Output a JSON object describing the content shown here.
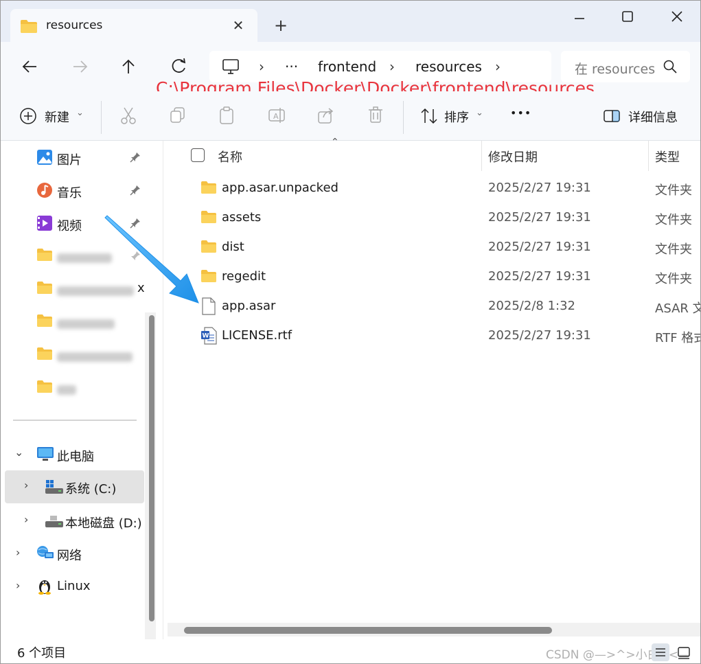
{
  "window": {
    "tab_title": "resources",
    "tab_close": "✕",
    "new_tab": "+"
  },
  "address": {
    "more": "···",
    "crumbs": [
      "frontend",
      "resources"
    ],
    "sep": "›",
    "search_placeholder": "在 resources 中搜索"
  },
  "annotation": {
    "path": "C:\\Program Files\\Docker\\Docker\\frontend\\resources"
  },
  "toolbar": {
    "new_label": "新建",
    "sort_label": "排序",
    "more": "•••",
    "details_label": "详细信息"
  },
  "sidebar": {
    "pinned": [
      {
        "label": "图片"
      },
      {
        "label": "音乐"
      },
      {
        "label": "视频"
      }
    ],
    "blurred_suffix": "x",
    "this_pc": "此电脑",
    "drives": [
      {
        "label": "系统 (C:)"
      },
      {
        "label": "本地磁盘 (D:)"
      }
    ],
    "network": "网络",
    "linux": "Linux"
  },
  "columns": {
    "name": "名称",
    "modified": "修改日期",
    "type": "类型"
  },
  "files": [
    {
      "name": "app.asar.unpacked",
      "date": "2025/2/27 19:31",
      "type": "文件夹",
      "icon": "folder-icon"
    },
    {
      "name": "assets",
      "date": "2025/2/27 19:31",
      "type": "文件夹",
      "icon": "folder-icon"
    },
    {
      "name": "dist",
      "date": "2025/2/27 19:31",
      "type": "文件夹",
      "icon": "folder-icon"
    },
    {
      "name": "regedit",
      "date": "2025/2/27 19:31",
      "type": "文件夹",
      "icon": "folder-icon"
    },
    {
      "name": "app.asar",
      "date": "2025/2/8 1:32",
      "type": "ASAR 文件",
      "icon": "file-icon"
    },
    {
      "name": "LICENSE.rtf",
      "date": "2025/2/27 19:31",
      "type": "RTF 格式",
      "icon": "word-doc-icon"
    }
  ],
  "status": {
    "count": "6 个项目",
    "watermark": "CSDN @—>^>小白^<—"
  },
  "colors": {
    "accent": "#1e90e8",
    "folder": "#f5c142",
    "annotation": "#e8343d"
  }
}
